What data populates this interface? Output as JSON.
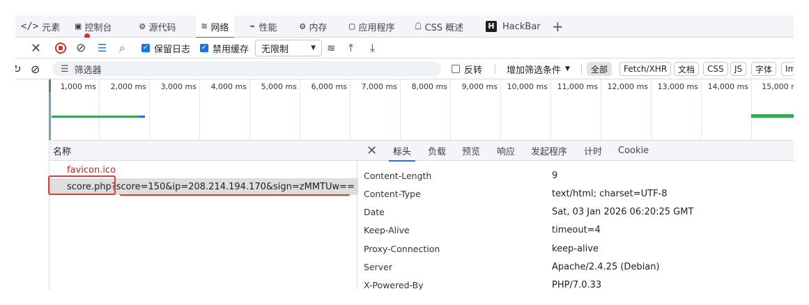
{
  "tabs": [
    {
      "icon": "</>",
      "label": "元素"
    },
    {
      "icon": "▣",
      "label": "控制台"
    },
    {
      "icon": "⚙",
      "label": "源代码"
    },
    {
      "icon": "≋",
      "label": "网络"
    },
    {
      "icon": "⌁",
      "label": "性能"
    },
    {
      "icon": "⚙",
      "label": "内存"
    },
    {
      "icon": "▢",
      "label": "应用程序"
    },
    {
      "icon": "☖",
      "label": "CSS 概述"
    },
    {
      "icon": "H",
      "label": "HackBar"
    },
    {
      "icon": "+",
      "label": ""
    }
  ],
  "toolbar": {
    "preserve_log": "保留日志",
    "disable_cache": "禁用缓存",
    "throttle": "无限制"
  },
  "filter": {
    "placeholder": "筛选器",
    "invert": "反转",
    "more_filters": "增加筛选条件",
    "chips": [
      "全部",
      "Fetch/XHR",
      "文档",
      "CSS",
      "JS",
      "字体",
      "Im"
    ]
  },
  "timeline": {
    "ticks": [
      "1,000 ms",
      "2,000 ms",
      "3,000 ms",
      "4,000 ms",
      "5,000 ms",
      "6,000 ms",
      "7,000 ms",
      "8,000 ms",
      "9,000 ms",
      "10,000 ms",
      "11,000 ms",
      "12,000 ms",
      "13,000 ms",
      "14,000 ms",
      "15,000 m"
    ]
  },
  "requests": {
    "column_name": "名称",
    "items": [
      {
        "name": "favicon.ico"
      },
      {
        "name": "score.php?score=150&ip=208.214.194.170&sign=zMMTUw=="
      }
    ]
  },
  "details": {
    "tabs": [
      "标头",
      "负载",
      "预览",
      "响应",
      "发起程序",
      "计时",
      "Cookie"
    ],
    "headers": [
      {
        "name": "Content-Length",
        "value": "9"
      },
      {
        "name": "Content-Type",
        "value": "text/html; charset=UTF-8"
      },
      {
        "name": "Date",
        "value": "Sat, 03 Jan 2026 06:20:25 GMT"
      },
      {
        "name": "Keep-Alive",
        "value": "timeout=4"
      },
      {
        "name": "Proxy-Connection",
        "value": "keep-alive"
      },
      {
        "name": "Server",
        "value": "Apache/2.4.25 (Debian)"
      },
      {
        "name": "X-Powered-By",
        "value": "PHP/7.0.33"
      }
    ]
  },
  "colors": {
    "accent": "#1a73e8",
    "record": "#d93025",
    "annotation": "#e53935",
    "timeline_green": "#34a853"
  }
}
